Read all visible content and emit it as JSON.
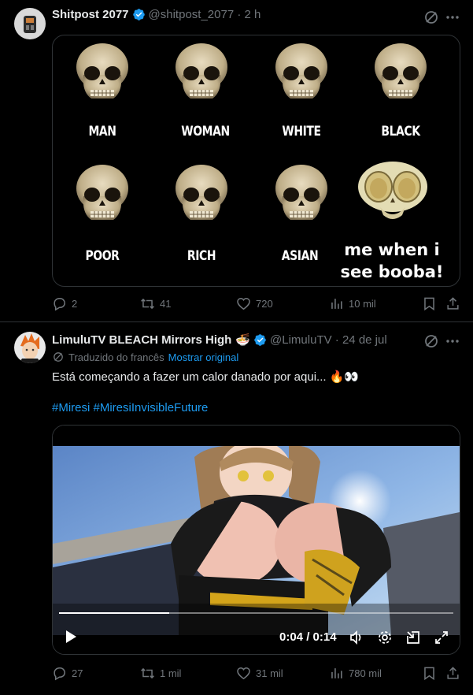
{
  "post1": {
    "display_name": "Shitpost 2077",
    "handle": "@shitpost_2077",
    "time": "2 h",
    "meme": {
      "labels": [
        "MAN",
        "WOMAN",
        "WHITE",
        "BLACK",
        "POOR",
        "RICH",
        "ASIAN"
      ],
      "caption_line1": "me when i",
      "caption_line2": "see booba!"
    },
    "replies": "2",
    "reposts": "41",
    "likes": "720",
    "views": "10 mil"
  },
  "post2": {
    "display_name": "LimuluTV BLEACH Mirrors High",
    "emoji": "🍜",
    "handle": "@LimuluTV",
    "time": "24 de jul",
    "translated_label": "Traduzido do francês",
    "show_original": "Mostrar original",
    "text": "Está começando a fazer um calor danado por aqui... 🔥👀",
    "hashtags": [
      "#Miresi",
      "#MiresiInvisibleFuture"
    ],
    "video": {
      "time_display": "0:04 / 0:14",
      "progress": 0.28
    },
    "replies": "27",
    "reposts": "1 mil",
    "likes": "31 mil",
    "views": "780 mil"
  },
  "colors": {
    "accent": "#1d9bf0",
    "muted": "#71767b",
    "border": "#2f3336"
  },
  "icons": [
    "verified-badge-icon",
    "grok-icon",
    "more-icon",
    "reply-icon",
    "repost-icon",
    "like-icon",
    "views-icon",
    "bookmark-icon",
    "share-icon",
    "play-icon",
    "volume-icon",
    "settings-icon",
    "pip-icon",
    "fullscreen-icon",
    "translate-icon"
  ]
}
